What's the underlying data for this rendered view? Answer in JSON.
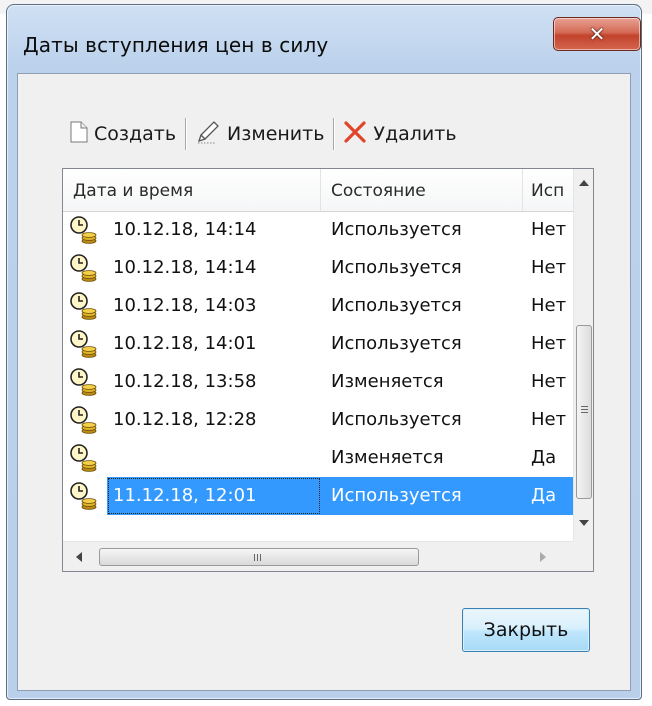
{
  "window": {
    "title": "Даты вступления цен в силу",
    "close_glyph": "✕"
  },
  "toolbar": {
    "create_label": "Создать",
    "edit_label": "Изменить",
    "delete_label": "Удалить"
  },
  "list": {
    "columns": [
      "Дата и время",
      "Состояние",
      "Исп"
    ],
    "rows": [
      {
        "datetime": "10.12.18, 14:14",
        "state": "Используется",
        "used": "Нет"
      },
      {
        "datetime": "10.12.18, 14:14",
        "state": "Используется",
        "used": "Нет"
      },
      {
        "datetime": "10.12.18, 14:03",
        "state": "Используется",
        "used": "Нет"
      },
      {
        "datetime": "10.12.18, 14:01",
        "state": "Используется",
        "used": "Нет"
      },
      {
        "datetime": "10.12.18, 13:58",
        "state": "Изменяется",
        "used": "Нет"
      },
      {
        "datetime": "10.12.18, 12:28",
        "state": "Используется",
        "used": "Нет"
      },
      {
        "datetime": "",
        "state": "Изменяется",
        "used": "Да"
      },
      {
        "datetime": "11.12.18, 12:01",
        "state": "Используется",
        "used": "Да",
        "selected": true
      }
    ]
  },
  "footer": {
    "close_button": "Закрыть"
  },
  "colors": {
    "selection": "#3399ff",
    "close_x": "#c2432c"
  },
  "icons": {
    "row_icon": "clock-coins-icon",
    "create": "new-document-icon",
    "edit": "pencil-icon",
    "delete": "red-x-icon"
  }
}
